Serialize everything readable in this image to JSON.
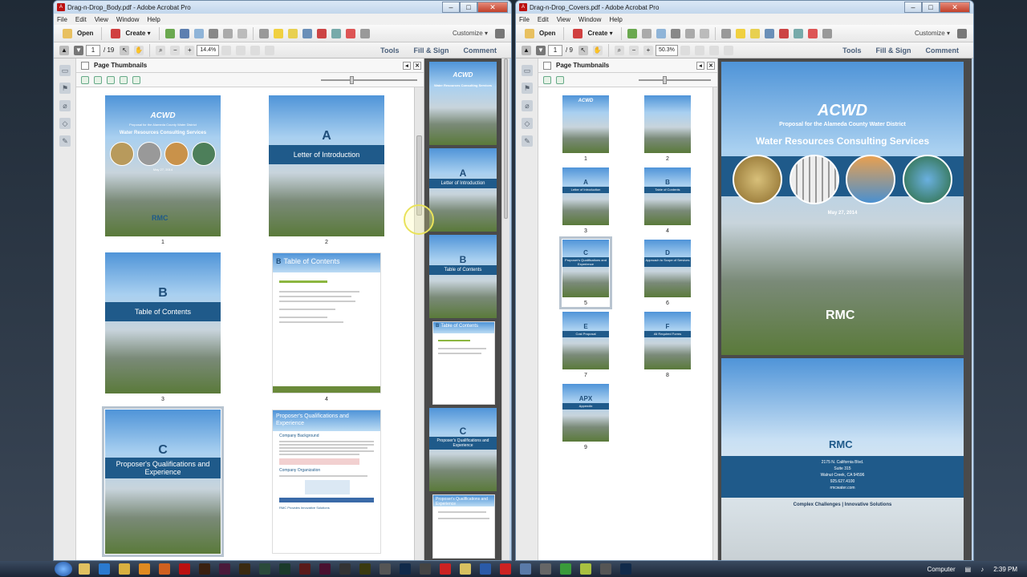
{
  "left_window": {
    "title": "Drag-n-Drop_Body.pdf - Adobe Acrobat Pro",
    "menu": [
      "File",
      "Edit",
      "View",
      "Window",
      "Help"
    ],
    "toolbar": {
      "open": "Open",
      "create": "Create",
      "customize": "Customize"
    },
    "nav": {
      "page": "1",
      "page_total": "/ 19",
      "zoom": "14.4%"
    },
    "links": [
      "Tools",
      "Fill & Sign",
      "Comment"
    ],
    "panel_title": "Page Thumbnails",
    "pages": [
      {
        "num": "1",
        "kind": "cover",
        "heading": "Water Resources Consulting Services",
        "logo": "ACWD",
        "subtitle": "Proposal for the Alameda County Water District",
        "date": "May 27, 2014",
        "brand": "RMC"
      },
      {
        "num": "2",
        "kind": "section",
        "letter": "A",
        "heading": "Letter of Introduction"
      },
      {
        "num": "3",
        "kind": "section",
        "letter": "B",
        "heading": "Table of Contents"
      },
      {
        "num": "4",
        "kind": "toc",
        "heading": "Table of Contents",
        "letter": "B"
      },
      {
        "num": "5",
        "kind": "section",
        "letter": "C",
        "heading": "Proposer's Qualifications and Experience"
      },
      {
        "num": "6",
        "kind": "doc",
        "heading": "Proposer's Qualifications and Experience",
        "letter": "C",
        "sub1": "Company Background",
        "sub2": "Company Organization",
        "sub3": "RMC Provides Innovative Solutions"
      }
    ],
    "strip": [
      {
        "letter": "",
        "heading": "Water Resources Consulting Services",
        "logo": "ACWD"
      },
      {
        "letter": "A",
        "heading": "Letter of Introduction"
      },
      {
        "letter": "B",
        "heading": "Table of Contents"
      },
      {
        "letter": "B",
        "heading": "Table of Contents",
        "kind": "toc"
      },
      {
        "letter": "C",
        "heading": "Proposer's Qualifications and Experience"
      },
      {
        "letter": "",
        "heading": "Proposer's Qualifications and Experience",
        "kind": "doc"
      }
    ]
  },
  "right_window": {
    "title": "Drag-n-Drop_Covers.pdf - Adobe Acrobat Pro",
    "menu": [
      "File",
      "Edit",
      "View",
      "Window",
      "Help"
    ],
    "toolbar": {
      "open": "Open",
      "create": "Create",
      "customize": "Customize"
    },
    "nav": {
      "page": "1",
      "page_total": "/ 9",
      "zoom": "50.3%"
    },
    "links": [
      "Tools",
      "Fill & Sign",
      "Comment"
    ],
    "panel_title": "Page Thumbnails",
    "pages": [
      {
        "num": "1",
        "letter": "",
        "heading": "ACWD"
      },
      {
        "num": "2",
        "letter": "",
        "heading": ""
      },
      {
        "num": "3",
        "letter": "A",
        "heading": "Letter of Introduction"
      },
      {
        "num": "4",
        "letter": "B",
        "heading": "Table of Contents"
      },
      {
        "num": "5",
        "letter": "C",
        "heading": "Proposer's Qualifications and Experience"
      },
      {
        "num": "6",
        "letter": "D",
        "heading": "Approach to Scope of Services"
      },
      {
        "num": "7",
        "letter": "E",
        "heading": "Cost Proposal"
      },
      {
        "num": "8",
        "letter": "F",
        "heading": "All Required Forms"
      },
      {
        "num": "9",
        "letter": "APX",
        "heading": "Appendix"
      }
    ],
    "preview": {
      "logo": "ACWD",
      "subtitle": "Proposal for the Alameda County Water District",
      "heading": "Water Resources Consulting Services",
      "date": "May 27, 2014",
      "brand": "RMC",
      "back_brand": "RMC",
      "address1": "2175 N. California Blvd.",
      "address2": "Suite 315",
      "address3": "Walnut Creek, CA 94596",
      "phone": "925.627.4100",
      "web": "rmcwater.com",
      "tagline": "Complex Challenges | Innovative Solutions"
    }
  },
  "taskbar": {
    "computer": "Computer",
    "time": "2:39 PM"
  }
}
